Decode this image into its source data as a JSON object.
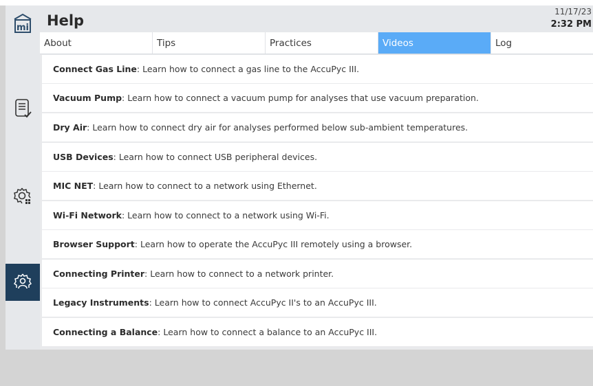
{
  "header": {
    "title": "Help",
    "date": "11/17/23",
    "time": "2:32 PM"
  },
  "tabs": [
    {
      "label": "About",
      "active": false
    },
    {
      "label": "Tips",
      "active": false
    },
    {
      "label": "Practices",
      "active": false
    },
    {
      "label": "Videos",
      "active": true
    },
    {
      "label": "Log",
      "active": false
    }
  ],
  "videos": [
    {
      "name": "Connect Gas Line",
      "desc": ": Learn how to connect a gas line to the AccuPyc III."
    },
    {
      "name": "Vacuum Pump",
      "desc": ": Learn how to connect a vacuum pump for analyses that use vacuum preparation."
    },
    {
      "name": "Dry Air",
      "desc": ": Learn how to connect dry air for analyses performed below sub-ambient temperatures."
    },
    {
      "name": "USB Devices",
      "desc": ": Learn how to connect USB peripheral devices."
    },
    {
      "name": "MIC NET",
      "desc": ": Learn how to connect to a network using Ethernet."
    },
    {
      "name": "Wi-Fi Network",
      "desc": ": Learn how to connect to a network using Wi-Fi."
    },
    {
      "name": "Browser Support",
      "desc": ": Learn how to operate the AccuPyc III remotely using a browser."
    },
    {
      "name": "Connecting Printer",
      "desc": ": Learn how to connect to a network printer."
    },
    {
      "name": "Legacy Instruments",
      "desc": ": Learn how to connect AccuPyc II's to an AccuPyc III."
    },
    {
      "name": "Connecting a Balance",
      "desc": ": Learn how to connect a balance to an AccuPyc III."
    }
  ],
  "sidebar": {
    "icons": [
      "home-icon",
      "report-icon",
      "settings-icon",
      "user-settings-icon"
    ],
    "active_color": "#1f3f5c"
  },
  "colors": {
    "active_tab": "#5aabf7",
    "sidebar": "#e6e8eb"
  }
}
